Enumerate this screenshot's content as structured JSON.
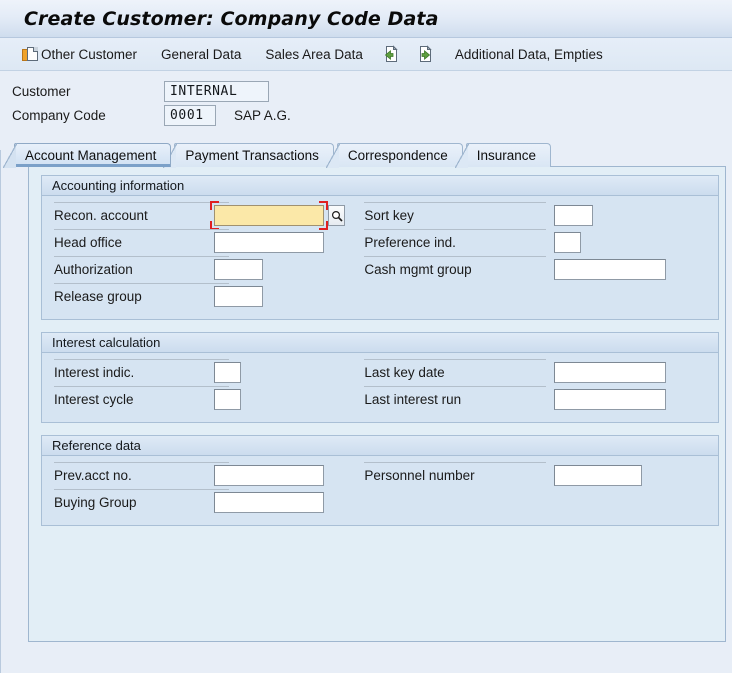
{
  "window": {
    "title": "Create Customer: Company Code Data"
  },
  "toolbar": {
    "items": [
      {
        "label": "Other Customer",
        "icon": "other-customer-icon"
      },
      {
        "label": "General Data",
        "icon": ""
      },
      {
        "label": "Sales Area Data",
        "icon": ""
      },
      {
        "label": "",
        "icon": "document-previous-icon"
      },
      {
        "label": "",
        "icon": "document-next-icon"
      },
      {
        "label": "Additional Data, Empties",
        "icon": ""
      }
    ]
  },
  "key_fields": {
    "customer": {
      "label": "Customer",
      "value": "INTERNAL"
    },
    "company_code": {
      "label": "Company Code",
      "value": "0001",
      "description": "SAP A.G."
    }
  },
  "tabs": [
    {
      "label": "Account Management",
      "active": true
    },
    {
      "label": "Payment Transactions",
      "active": false
    },
    {
      "label": "Correspondence",
      "active": false
    },
    {
      "label": "Insurance",
      "active": false
    }
  ],
  "groups": [
    {
      "title": "Accounting information",
      "rows": [
        {
          "left": {
            "label": "Recon. account",
            "value": "",
            "placeholder": "",
            "width": 110,
            "focused": true,
            "has_f4": true
          },
          "right": {
            "label": "Sort key",
            "value": "",
            "placeholder": "",
            "width": 39,
            "focused": false,
            "has_f4": false
          }
        },
        {
          "left": {
            "label": "Head office",
            "value": "",
            "placeholder": "",
            "width": 110,
            "focused": false,
            "has_f4": false
          },
          "right": {
            "label": "Preference ind.",
            "value": "",
            "placeholder": "",
            "width": 27,
            "focused": false,
            "has_f4": false
          }
        },
        {
          "left": {
            "label": "Authorization",
            "value": "",
            "placeholder": "",
            "width": 49,
            "focused": false,
            "has_f4": false
          },
          "right": {
            "label": "Cash mgmt group",
            "value": "",
            "placeholder": "",
            "width": 112,
            "focused": false,
            "has_f4": false
          }
        },
        {
          "left": {
            "label": "Release group",
            "value": "",
            "placeholder": "",
            "width": 49,
            "focused": false,
            "has_f4": false
          },
          "right": null
        }
      ]
    },
    {
      "title": "Interest calculation",
      "rows": [
        {
          "left": {
            "label": "Interest indic.",
            "value": "",
            "placeholder": "",
            "width": 27,
            "focused": false,
            "has_f4": false
          },
          "right": {
            "label": "Last key date",
            "value": "",
            "placeholder": "",
            "width": 112,
            "focused": false,
            "has_f4": false
          }
        },
        {
          "left": {
            "label": "Interest cycle",
            "value": "",
            "placeholder": "",
            "width": 27,
            "focused": false,
            "has_f4": false
          },
          "right": {
            "label": "Last interest run",
            "value": "",
            "placeholder": "",
            "width": 112,
            "focused": false,
            "has_f4": false
          }
        }
      ]
    },
    {
      "title": "Reference data",
      "rows": [
        {
          "left": {
            "label": "Prev.acct no.",
            "value": "",
            "placeholder": "",
            "width": 110,
            "focused": false,
            "has_f4": false
          },
          "right": {
            "label": "Personnel number",
            "value": "",
            "placeholder": "",
            "width": 88,
            "focused": false,
            "has_f4": false
          }
        },
        {
          "left": {
            "label": "Buying Group",
            "value": "",
            "placeholder": "",
            "width": 110,
            "focused": false,
            "has_f4": false
          },
          "right": null
        }
      ]
    }
  ],
  "colors": {
    "title_bar": "#cfddee",
    "tab_active_underline": "#7ba0c8",
    "group_background": "#d6e4f2",
    "tab_body_background": "#e2eef6",
    "focus_field": "#fbe8a8",
    "focus_marker": "#e02020"
  }
}
